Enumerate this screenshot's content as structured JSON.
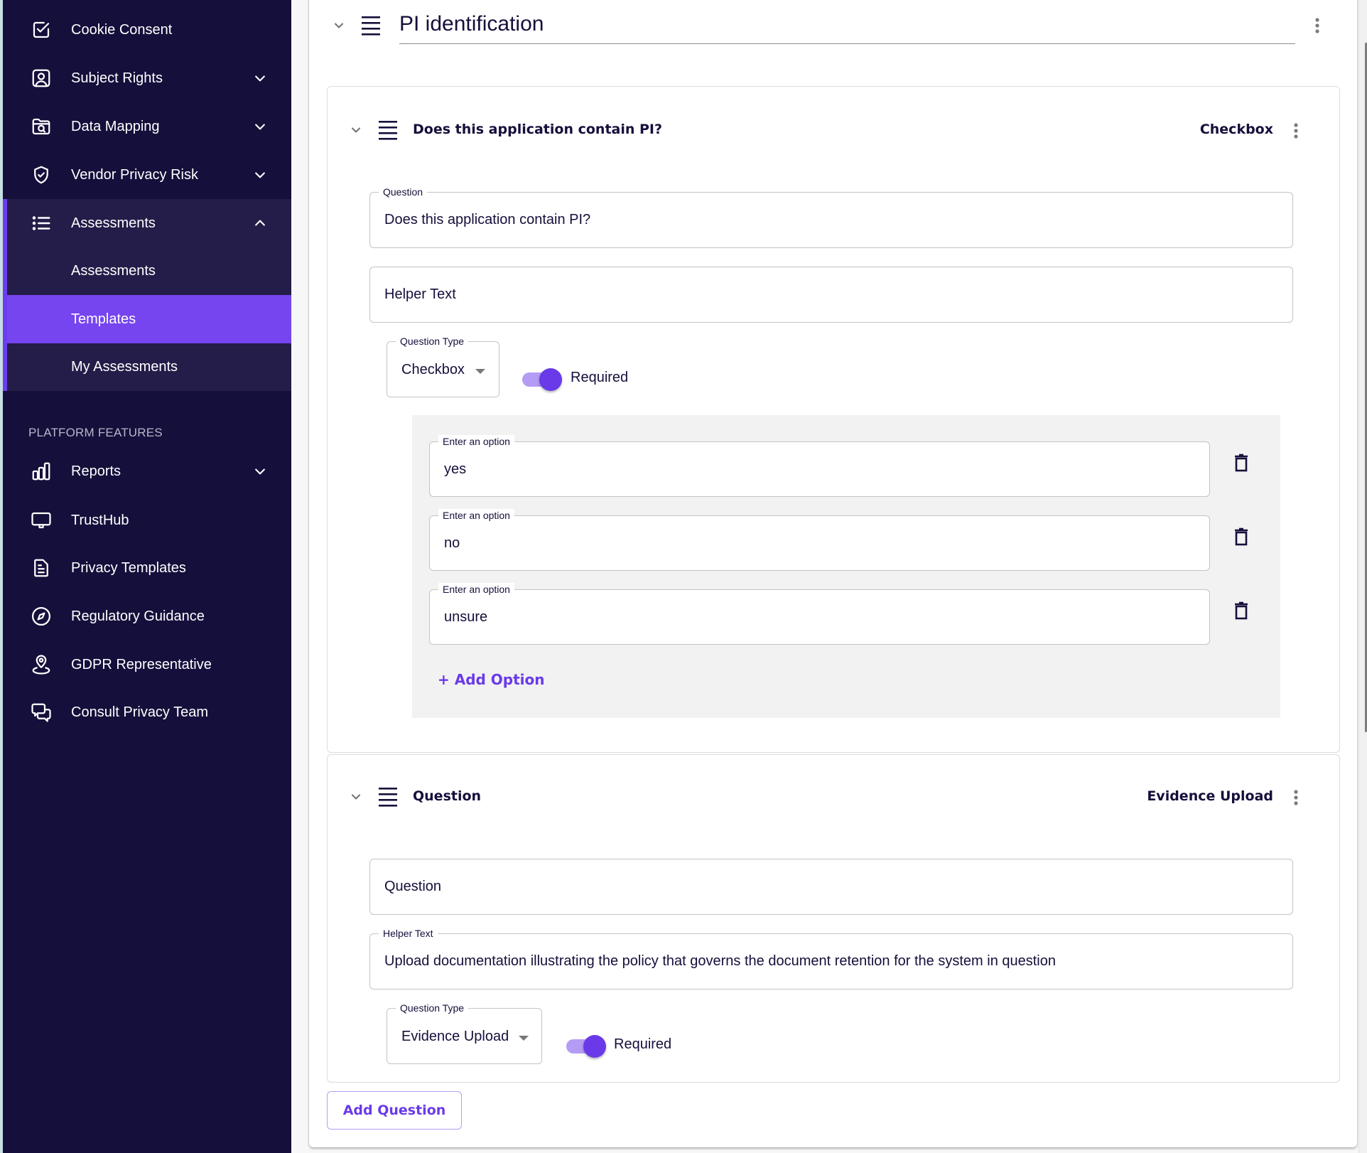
{
  "sidebar": {
    "items": [
      {
        "label": "Cookie Consent",
        "icon": "checkbox-icon",
        "has_chevron": false
      },
      {
        "label": "Subject Rights",
        "icon": "user-portrait-icon",
        "has_chevron": true
      },
      {
        "label": "Data Mapping",
        "icon": "folder-search-icon",
        "has_chevron": true
      },
      {
        "label": "Vendor Privacy Risk",
        "icon": "shield-check-icon",
        "has_chevron": true
      }
    ],
    "assessments_group": {
      "label": "Assessments",
      "icon": "list-icon",
      "expanded": true,
      "children": [
        {
          "label": "Assessments",
          "active": false
        },
        {
          "label": "Templates",
          "active": true
        },
        {
          "label": "My Assessments",
          "active": false
        }
      ]
    },
    "platform_heading": "PLATFORM FEATURES",
    "platform_items": [
      {
        "label": "Reports",
        "icon": "bar-chart-icon",
        "has_chevron": true
      },
      {
        "label": "TrustHub",
        "icon": "monitor-icon",
        "has_chevron": false
      },
      {
        "label": "Privacy Templates",
        "icon": "document-icon",
        "has_chevron": false
      },
      {
        "label": "Regulatory Guidance",
        "icon": "compass-icon",
        "has_chevron": false
      },
      {
        "label": "GDPR Representative",
        "icon": "location-pin-icon",
        "has_chevron": false
      },
      {
        "label": "Consult Privacy Team",
        "icon": "chat-bubbles-icon",
        "has_chevron": false
      }
    ],
    "colors": {
      "background": "#150f3b",
      "group_background": "#241d49",
      "active": "#7645ef",
      "accent": "#6a3ef0"
    }
  },
  "section": {
    "title": "PI identification"
  },
  "questions": [
    {
      "header_title": "Does this application contain PI?",
      "header_type": "Checkbox",
      "question_label": "Question",
      "question_value": "Does this application contain PI?",
      "question_placeholder": "Question",
      "helper_label": "Helper Text",
      "helper_value": "",
      "helper_placeholder": "Helper Text",
      "type_label": "Question Type",
      "type_value": "Checkbox",
      "required_label": "Required",
      "required": true,
      "option_label": "Enter an option",
      "options": [
        "yes",
        "no",
        "unsure"
      ],
      "add_option_label": "+ Add Option"
    },
    {
      "header_title": "Question",
      "header_type": "Evidence Upload",
      "question_label": "Question",
      "question_value": "",
      "question_placeholder": "Question",
      "helper_label": "Helper Text",
      "helper_value": "Upload documentation illustrating the policy that governs the document retention for the system in question",
      "type_label": "Question Type",
      "type_value": "Evidence Upload",
      "required_label": "Required",
      "required": true
    }
  ],
  "add_question_label": "Add Question",
  "colors": {
    "primary": "#6a3ae8",
    "text": "#150f3b",
    "toggle_track": "#b49cf4"
  }
}
